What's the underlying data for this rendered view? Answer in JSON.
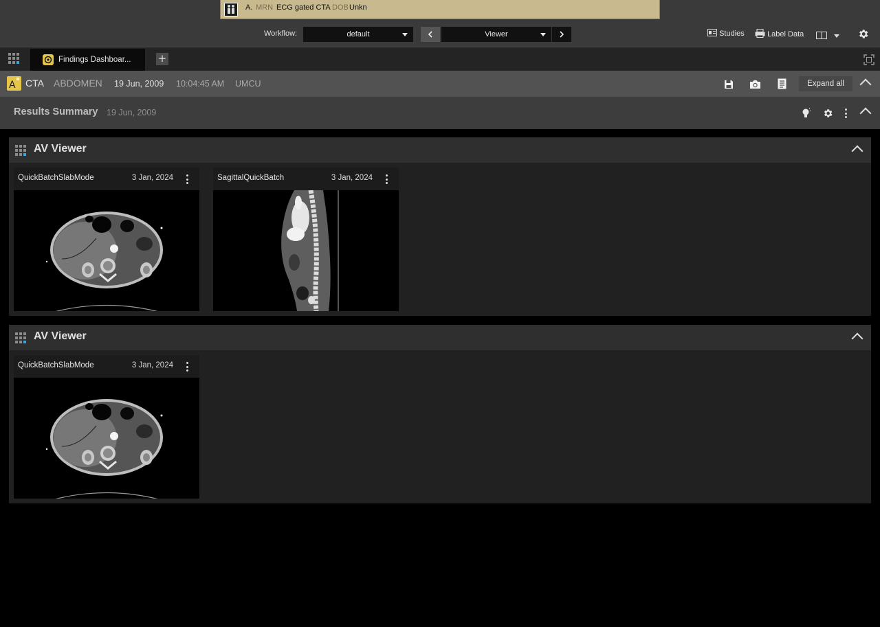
{
  "patient_banner": {
    "name": "A.",
    "mrn_label": "MRN",
    "study": "ECG gated CTA",
    "dob_label": "DOB",
    "dob_value": "Unkn"
  },
  "toolbar": {
    "workflow_label": "Workflow:",
    "workflow_value": "default",
    "prev_icon": "chevron-left-icon",
    "viewer_value": "Viewer",
    "next_icon": "chevron-right-icon",
    "studies_label": "Studies",
    "label_data_label": "Label Data",
    "layout_icon": "book-icon",
    "settings_icon": "gear-icon"
  },
  "tabs": {
    "apps_icon": "app-grid-icon",
    "items": [
      {
        "label": "Findings Dashboar...",
        "icon": "shield-icon",
        "active": true
      }
    ],
    "add_icon": "plus-icon",
    "fullscreen_icon": "fullscreen-icon"
  },
  "study_header": {
    "modality": "CTA",
    "body_part": "ABDOMEN",
    "date": "19 Jun, 2009",
    "time": "10:04:45 AM",
    "institution": "UMCU",
    "expand_all": "Expand all"
  },
  "results_summary": {
    "title": "Results Summary",
    "date": "19 Jun, 2009"
  },
  "panels": [
    {
      "title": "AV Viewer",
      "cards": [
        {
          "name": "QuickBatchSlabMode",
          "date": "3 Jan, 2024",
          "image": "axial-ct"
        },
        {
          "name": "SagittalQuickBatch",
          "date": "3 Jan, 2024",
          "image": "sagittal-ct"
        }
      ]
    },
    {
      "title": "AV Viewer",
      "cards": [
        {
          "name": "QuickBatchSlabMode",
          "date": "3 Jan, 2024",
          "image": "axial-ct"
        }
      ]
    }
  ],
  "colors": {
    "banner_bg": "#c8b98f",
    "accent_yellow": "#e6c64a",
    "accent_blue": "#3aa4e0"
  }
}
